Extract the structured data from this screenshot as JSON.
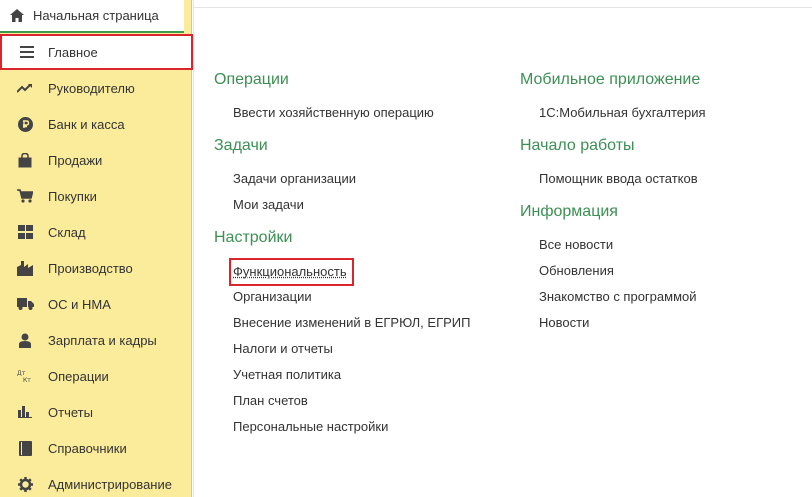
{
  "home_tab": {
    "label": "Начальная страница",
    "icon": "home-icon"
  },
  "sidebar": {
    "items": [
      {
        "label": "Главное",
        "icon": "menu-icon",
        "active": true
      },
      {
        "label": "Руководителю",
        "icon": "trend-icon"
      },
      {
        "label": "Банк и касса",
        "icon": "ruble-icon"
      },
      {
        "label": "Продажи",
        "icon": "shopping-bag-icon"
      },
      {
        "label": "Покупки",
        "icon": "cart-icon"
      },
      {
        "label": "Склад",
        "icon": "grid-icon"
      },
      {
        "label": "Производство",
        "icon": "factory-icon"
      },
      {
        "label": "ОС и НМА",
        "icon": "truck-icon"
      },
      {
        "label": "Зарплата и кадры",
        "icon": "person-icon"
      },
      {
        "label": "Операции",
        "icon": "debit-credit-icon"
      },
      {
        "label": "Отчеты",
        "icon": "bar-chart-icon"
      },
      {
        "label": "Справочники",
        "icon": "book-icon"
      },
      {
        "label": "Администрирование",
        "icon": "gear-icon"
      }
    ]
  },
  "content": {
    "col1": [
      {
        "title": "Операции",
        "links": [
          "Ввести хозяйственную операцию"
        ]
      },
      {
        "title": "Задачи",
        "links": [
          "Задачи организации",
          "Мои задачи"
        ]
      },
      {
        "title": "Настройки",
        "links": [
          "Функциональность",
          "Организации",
          "Внесение изменений в ЕГРЮЛ, ЕГРИП",
          "Налоги и отчеты",
          "Учетная политика",
          "План счетов",
          "Персональные настройки"
        ]
      }
    ],
    "col2": [
      {
        "title": "Мобильное приложение",
        "links": [
          "1С:Мобильная бухгалтерия"
        ]
      },
      {
        "title": "Начало работы",
        "links": [
          "Помощник ввода остатков"
        ]
      },
      {
        "title": "Информация",
        "links": [
          "Все новости",
          "Обновления",
          "Знакомство с программой",
          "Новости"
        ]
      }
    ]
  },
  "colors": {
    "sidebar_bg": "#fbec9c",
    "accent_green": "#3d8f55",
    "highlight_red": "#d9252b"
  }
}
